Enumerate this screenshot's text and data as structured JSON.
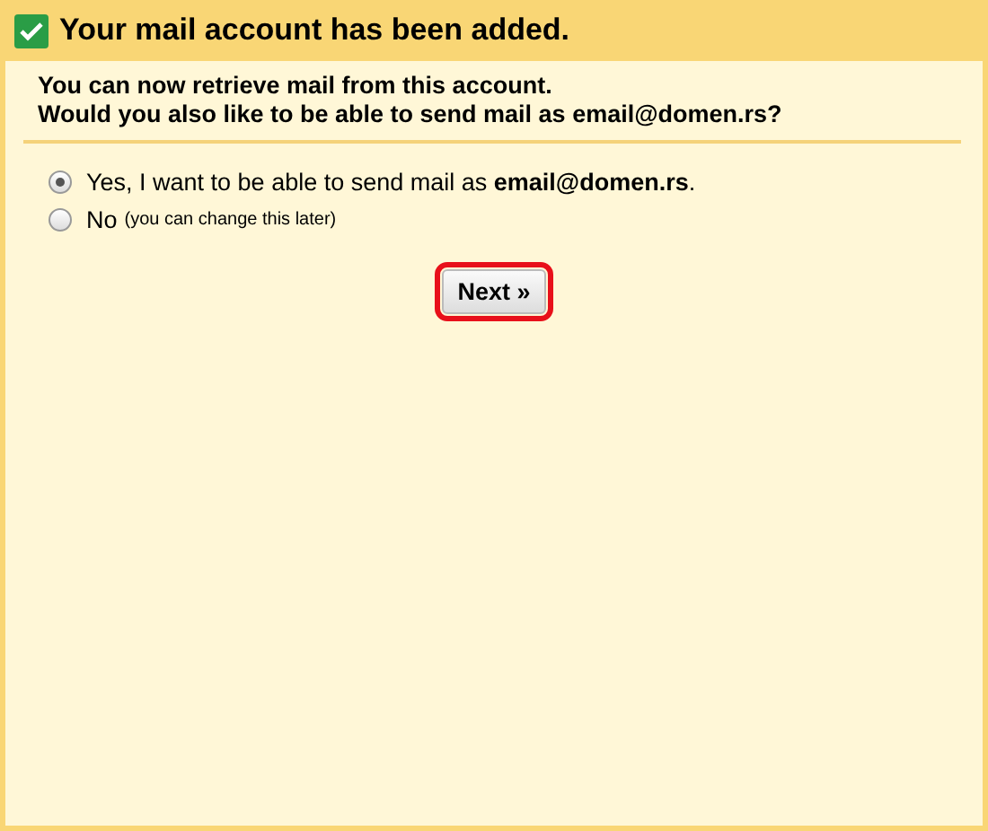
{
  "title": "Your mail account has been added.",
  "message": [
    "You can now retrieve mail from this account.",
    "Would you also like to be able to send mail as email@domen.rs?"
  ],
  "options": [
    {
      "label": "Yes, I want to be able to send mail as **email@domen.rs**.",
      "selected": true
    },
    {
      "label": "No",
      "hint": "(you can change this later)",
      "selected": false
    }
  ],
  "button": {
    "label": "Next »",
    "highlighted": true
  }
}
